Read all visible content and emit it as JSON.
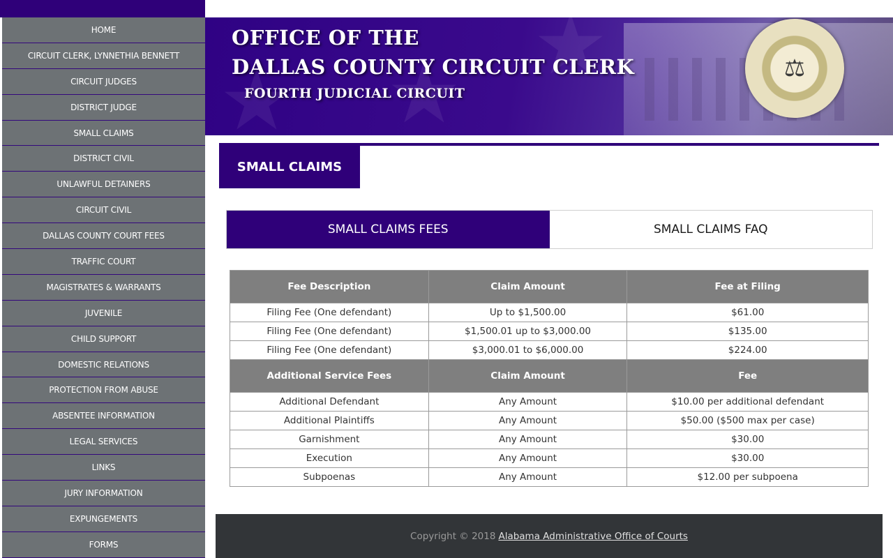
{
  "sidebar": {
    "items": [
      {
        "label": "HOME"
      },
      {
        "label": "CIRCUIT CLERK, LYNNETHIA BENNETT"
      },
      {
        "label": "CIRCUIT JUDGES"
      },
      {
        "label": "DISTRICT JUDGE"
      },
      {
        "label": "SMALL CLAIMS"
      },
      {
        "label": "DISTRICT CIVIL"
      },
      {
        "label": "UNLAWFUL DETAINERS"
      },
      {
        "label": "CIRCUIT CIVIL"
      },
      {
        "label": "DALLAS COUNTY COURT FEES"
      },
      {
        "label": "TRAFFIC COURT"
      },
      {
        "label": "MAGISTRATES & WARRANTS"
      },
      {
        "label": "JUVENILE"
      },
      {
        "label": "CHILD SUPPORT"
      },
      {
        "label": "DOMESTIC RELATIONS"
      },
      {
        "label": "PROTECTION FROM ABUSE"
      },
      {
        "label": "ABSENTEE INFORMATION"
      },
      {
        "label": "LEGAL SERVICES"
      },
      {
        "label": "LINKS"
      },
      {
        "label": "JURY INFORMATION"
      },
      {
        "label": "EXPUNGEMENTS"
      },
      {
        "label": "FORMS"
      }
    ]
  },
  "banner": {
    "line1": "OFFICE OF THE",
    "line2": "DALLAS COUNTY CIRCUIT CLERK",
    "line3": "FOURTH JUDICIAL CIRCUIT",
    "seal_icon": "scales-of-justice-icon"
  },
  "main": {
    "page_title": "SMALL CLAIMS",
    "tabs": [
      {
        "label": "SMALL CLAIMS FEES",
        "active": true
      },
      {
        "label": "SMALL CLAIMS FAQ",
        "active": false
      }
    ],
    "table": {
      "section1_headers": [
        "Fee Description",
        "Claim Amount",
        "Fee at Filing"
      ],
      "section1_rows": [
        [
          "Filing Fee (One defendant)",
          "Up to $1,500.00",
          "$61.00"
        ],
        [
          "Filing Fee (One defendant)",
          "$1,500.01 up to $3,000.00",
          "$135.00"
        ],
        [
          "Filing Fee (One defendant)",
          "$3,000.01 to $6,000.00",
          "$224.00"
        ]
      ],
      "section2_headers": [
        "Additional Service Fees",
        "Claim Amount",
        "Fee"
      ],
      "section2_rows": [
        [
          "Additional Defendant",
          "Any Amount",
          "$10.00 per additional defendant"
        ],
        [
          "Additional Plaintiffs",
          "Any Amount",
          "$50.00 ($500 max per case)"
        ],
        [
          "Garnishment",
          "Any Amount",
          "$30.00"
        ],
        [
          "Execution",
          "Any Amount",
          "$30.00"
        ],
        [
          "Subpoenas",
          "Any Amount",
          "$12.00 per subpoena"
        ]
      ]
    }
  },
  "footer": {
    "copyright": "Copyright © 2018",
    "link_label": "Alabama Administrative Office of Courts"
  },
  "colors": {
    "brand_purple": "#2f0079",
    "nav_gray": "#6d7275",
    "table_header_gray": "#7f7f7f",
    "footer_dark": "#323538"
  }
}
